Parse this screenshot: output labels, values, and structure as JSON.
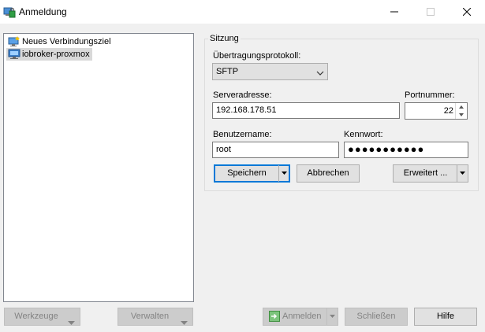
{
  "window": {
    "title": "Anmeldung",
    "icons": {
      "app": "login-app-icon",
      "minimize": "minimize-icon",
      "maximize": "maximize-icon",
      "close": "close-icon"
    }
  },
  "sites": [
    {
      "label": "Neues Verbindungsziel",
      "icon": "new-site-icon",
      "selected": false
    },
    {
      "label": "iobroker-proxmox",
      "icon": "computer-icon",
      "selected": true
    }
  ],
  "session": {
    "group_title": "Sitzung",
    "protocol_label": "Übertragungsprotokoll:",
    "protocol_value": "SFTP",
    "host_label": "Serveradresse:",
    "host_value": "192.168.178.51",
    "port_label": "Portnummer:",
    "port_value": "22",
    "user_label": "Benutzername:",
    "user_value": "root",
    "password_label": "Kennwort:",
    "password_masked": "●●●●●●●●●●●",
    "save_label": "Speichern",
    "cancel_label": "Abbrechen",
    "advanced_label": "Erweitert ..."
  },
  "footer": {
    "tools_label": "Werkzeuge",
    "manage_label": "Verwalten",
    "login_label": "Anmelden",
    "close_label": "Schließen",
    "help_label": "Hilfe"
  },
  "colors": {
    "accent": "#0078d7",
    "window_bg": "#f0f0f0",
    "selection": "#d9d9d9",
    "disabled_text": "#838383"
  }
}
